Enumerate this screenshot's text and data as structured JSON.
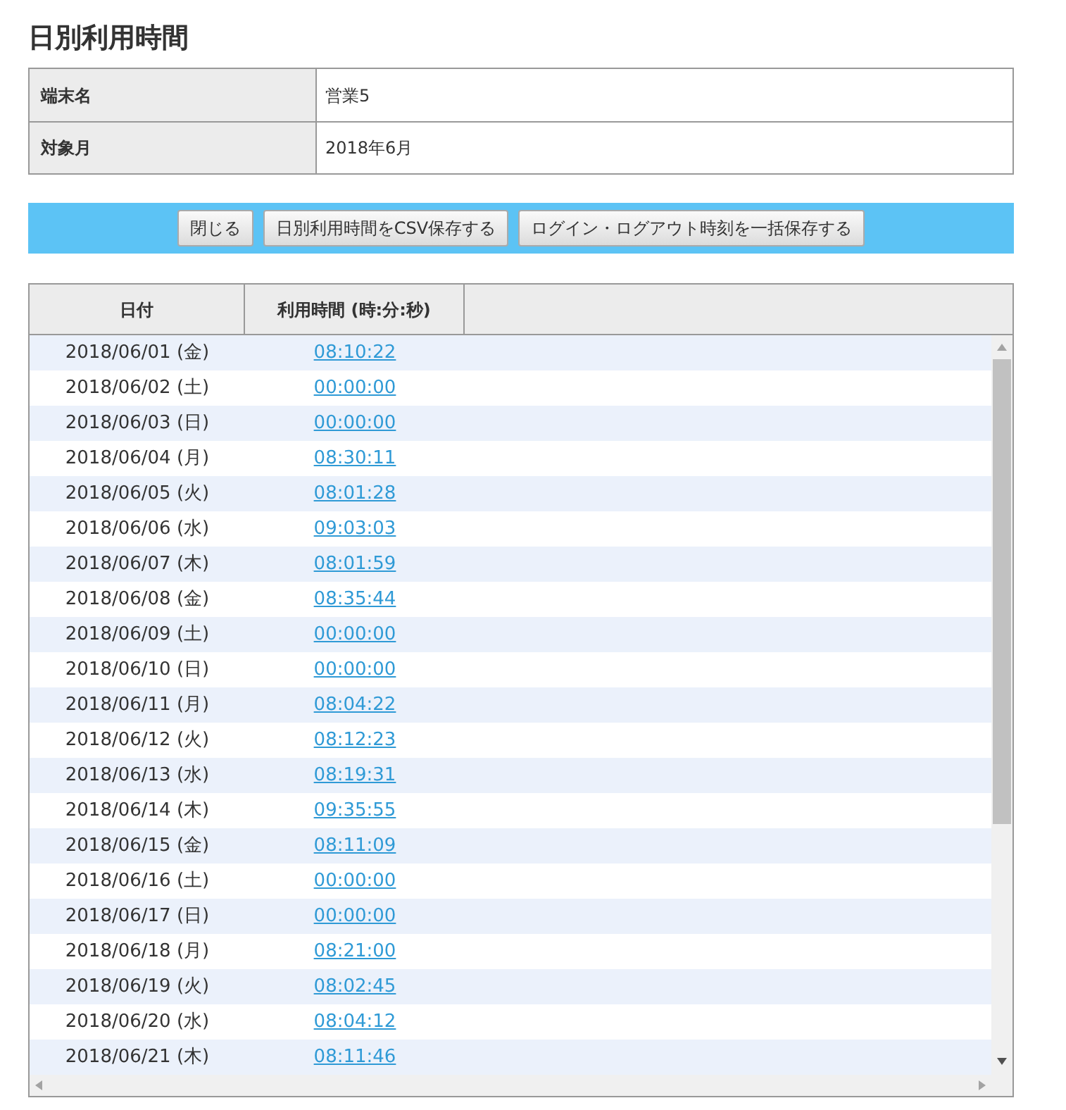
{
  "title": "日別利用時間",
  "info": [
    {
      "label": "端末名",
      "value": "営業5"
    },
    {
      "label": "対象月",
      "value": "2018年6月"
    }
  ],
  "buttons": [
    "閉じる",
    "日別利用時間をCSV保存する",
    "ログイン・ログアウト時刻を一括保存する"
  ],
  "table": {
    "columns": [
      "日付",
      "利用時間 (時:分:秒)"
    ],
    "rows": [
      {
        "date": "2018/06/01 (金)",
        "time": "08:10:22"
      },
      {
        "date": "2018/06/02 (土)",
        "time": "00:00:00"
      },
      {
        "date": "2018/06/03 (日)",
        "time": "00:00:00"
      },
      {
        "date": "2018/06/04 (月)",
        "time": "08:30:11"
      },
      {
        "date": "2018/06/05 (火)",
        "time": "08:01:28"
      },
      {
        "date": "2018/06/06 (水)",
        "time": "09:03:03"
      },
      {
        "date": "2018/06/07 (木)",
        "time": "08:01:59"
      },
      {
        "date": "2018/06/08 (金)",
        "time": "08:35:44"
      },
      {
        "date": "2018/06/09 (土)",
        "time": "00:00:00"
      },
      {
        "date": "2018/06/10 (日)",
        "time": "00:00:00"
      },
      {
        "date": "2018/06/11 (月)",
        "time": "08:04:22"
      },
      {
        "date": "2018/06/12 (火)",
        "time": "08:12:23"
      },
      {
        "date": "2018/06/13 (水)",
        "time": "08:19:31"
      },
      {
        "date": "2018/06/14 (木)",
        "time": "09:35:55"
      },
      {
        "date": "2018/06/15 (金)",
        "time": "08:11:09"
      },
      {
        "date": "2018/06/16 (土)",
        "time": "00:00:00"
      },
      {
        "date": "2018/06/17 (日)",
        "time": "00:00:00"
      },
      {
        "date": "2018/06/18 (月)",
        "time": "08:21:00"
      },
      {
        "date": "2018/06/19 (火)",
        "time": "08:02:45"
      },
      {
        "date": "2018/06/20 (水)",
        "time": "08:04:12"
      },
      {
        "date": "2018/06/21 (木)",
        "time": "08:11:46"
      }
    ]
  }
}
